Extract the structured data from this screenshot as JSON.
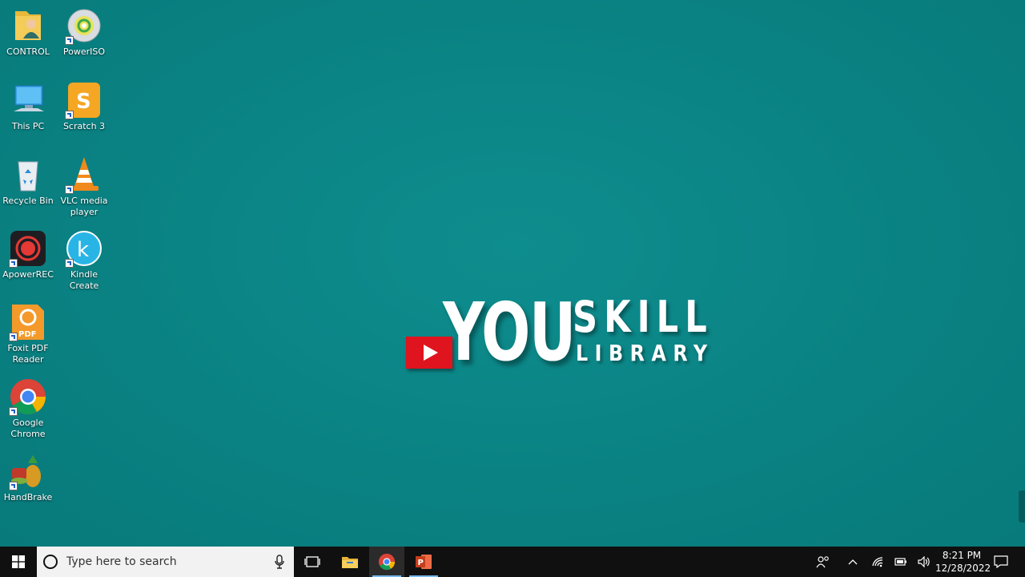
{
  "desktop_icons": [
    {
      "label": "CONTROL"
    },
    {
      "label": "PowerISO"
    },
    {
      "label": "This PC"
    },
    {
      "label": "Scratch 3"
    },
    {
      "label": "Recycle Bin"
    },
    {
      "label": "VLC media player"
    },
    {
      "label": "ApowerREC"
    },
    {
      "label": "Kindle Create"
    },
    {
      "label": "Foxit PDF Reader"
    },
    {
      "label": "Google Chrome"
    },
    {
      "label": "HandBrake"
    }
  ],
  "logo": {
    "you": "YOU",
    "skill": "SKILL",
    "library": "LIBRARY"
  },
  "taskbar": {
    "search_placeholder": "Type here to search",
    "clock_time": "8:21 PM",
    "clock_date": "12/28/2022"
  },
  "colors": {
    "desktop": "#0b8586",
    "taskbar": "#101010",
    "accent": "#76b9ed",
    "youtube_red": "#e0141e"
  }
}
